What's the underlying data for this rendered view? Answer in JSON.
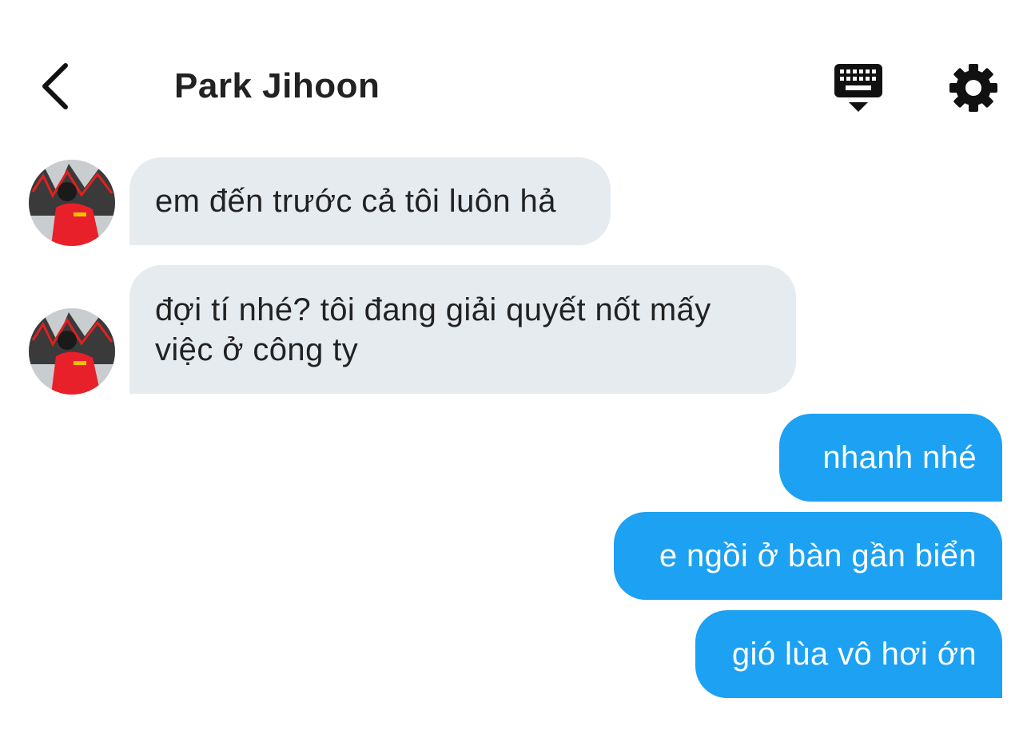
{
  "header": {
    "title": "Park Jihoon",
    "back_icon": "chevron-left-icon",
    "keyboard_icon": "keyboard-icon",
    "settings_icon": "gear-icon"
  },
  "colors": {
    "incoming_bubble": "#e6ebf0",
    "outgoing_bubble": "#1da1f2",
    "text_dark": "#222222",
    "text_light": "#ffffff"
  },
  "messages": [
    {
      "direction": "incoming",
      "text": "em đến trước cả tôi luôn hả"
    },
    {
      "direction": "incoming",
      "text": "đợi tí nhé? tôi đang giải quyết nốt mấy việc ở công ty"
    },
    {
      "direction": "outgoing",
      "text": "nhanh nhé"
    },
    {
      "direction": "outgoing",
      "text": "e ngồi ở bàn gần biển"
    },
    {
      "direction": "outgoing",
      "text": "gió lùa vô hơi ớn"
    }
  ]
}
